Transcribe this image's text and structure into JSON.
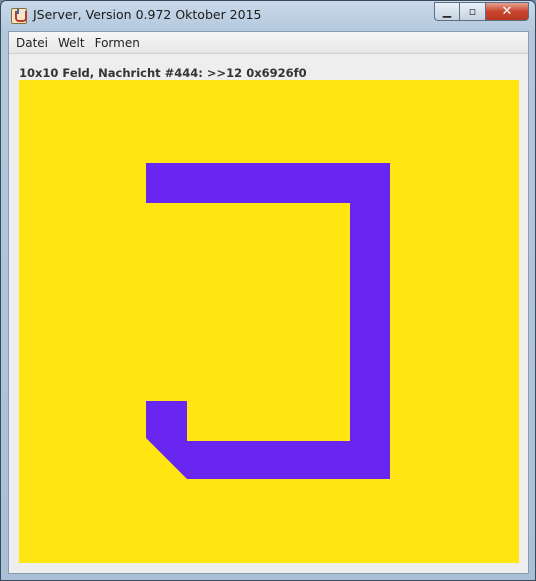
{
  "window": {
    "title": "JServer, Version 0.972 Oktober 2015",
    "controls": {
      "minimize_glyph": "▁",
      "maximize_glyph": "▫",
      "close_glyph": "✕"
    }
  },
  "menubar": {
    "items": [
      {
        "label": "Datei"
      },
      {
        "label": "Welt"
      },
      {
        "label": "Formen"
      }
    ]
  },
  "status_text": "10x10 Feld, Nachricht #444: >>12 0x6926f0",
  "board": {
    "background_color": "#ffe512",
    "shape_color": "#6926f0",
    "grid_size": "10x10"
  }
}
